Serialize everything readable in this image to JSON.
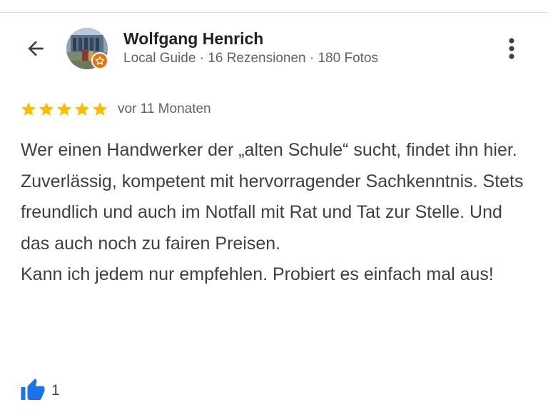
{
  "reviewer": {
    "name": "Wolfgang Henrich",
    "meta": "Local Guide · 16 Rezensionen · 180 Fotos",
    "avatar": "user-avatar-photo",
    "badge_icon": "local-guide-star-icon",
    "badge_color": "#e8710a"
  },
  "header": {
    "back_icon": "arrow-left-icon",
    "more_icon": "more-vert-icon"
  },
  "review": {
    "rating": 5,
    "max_rating": 5,
    "star_color": "#fbbc04",
    "date": "vor 11 Monaten",
    "paragraph_1": "Wer einen Handwerker der „alten Schule“ sucht, findet ihn hier. Zuverlässig, kompetent mit hervorragender Sachkenntnis. Stets freundlich und auch im Notfall mit Rat und Tat zur Stelle. Und das auch noch zu fairen Preisen.",
    "paragraph_2": "Kann ich jedem nur empfehlen. Probiert es einfach mal aus!"
  },
  "actions": {
    "like_icon": "thumbs-up-icon",
    "like_color": "#1a73e8",
    "like_count": "1"
  }
}
